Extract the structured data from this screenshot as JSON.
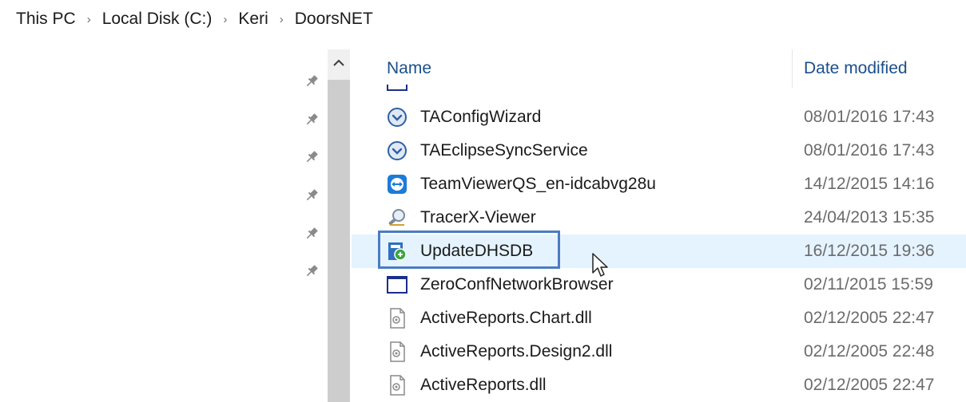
{
  "breadcrumb": {
    "items": [
      "This PC",
      "Local Disk (C:)",
      "Keri",
      "DoorsNET"
    ]
  },
  "columns": {
    "name": "Name",
    "date_modified": "Date modified"
  },
  "files": [
    {
      "name": "TAConfigWizard",
      "date": "08/01/2016 17:43",
      "icon": "setup-app-icon"
    },
    {
      "name": "TAEclipseSyncService",
      "date": "08/01/2016 17:43",
      "icon": "setup-app-icon"
    },
    {
      "name": "TeamViewerQS_en-idcabvg28u",
      "date": "14/12/2015 14:16",
      "icon": "teamviewer-icon"
    },
    {
      "name": "TracerX-Viewer",
      "date": "24/04/2013 15:35",
      "icon": "tracer-magnifier-icon"
    },
    {
      "name": "UpdateDHSDB",
      "date": "16/12/2015 19:36",
      "icon": "database-update-icon",
      "selected": true
    },
    {
      "name": "ZeroConfNetworkBrowser",
      "date": "02/11/2015 15:59",
      "icon": "window-app-icon"
    },
    {
      "name": "ActiveReports.Chart.dll",
      "date": "02/12/2005 22:47",
      "icon": "dll-file-icon"
    },
    {
      "name": "ActiveReports.Design2.dll",
      "date": "02/12/2005 22:48",
      "icon": "dll-file-icon"
    },
    {
      "name": "ActiveReports.dll",
      "date": "02/12/2005 22:47",
      "icon": "dll-file-icon"
    }
  ],
  "partial_top_row": {
    "icon": "window-app-icon"
  },
  "quick_access_pins": 6,
  "colors": {
    "selection": "#e5f3ff",
    "highlight_border": "#4a7cc2",
    "header_text": "#1a4f8c",
    "date_text": "#6b6b6b"
  }
}
